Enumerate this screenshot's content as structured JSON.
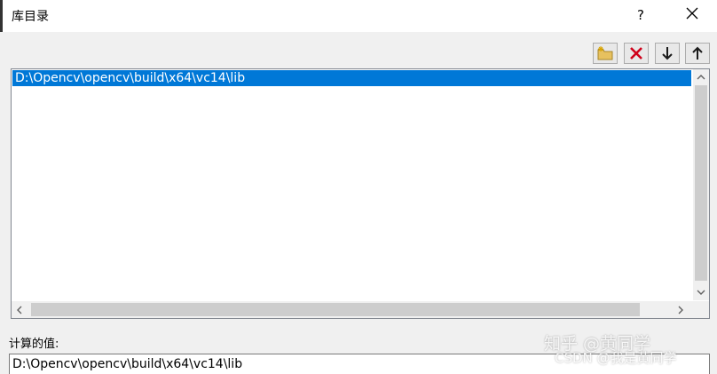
{
  "dialog": {
    "title": "库目录",
    "help_label": "?"
  },
  "toolbar": {
    "buttons": [
      {
        "name": "new-line-icon"
      },
      {
        "name": "delete-icon"
      },
      {
        "name": "move-down-icon"
      },
      {
        "name": "move-up-icon"
      }
    ]
  },
  "list": {
    "items": [
      "D:\\Opencv\\opencv\\build\\x64\\vc14\\lib"
    ]
  },
  "computed": {
    "label": "计算的值:",
    "value": "D:\\Opencv\\opencv\\build\\x64\\vc14\\lib"
  },
  "watermark": {
    "zhihu": "知乎 @黄同学",
    "csdn": "CSDN @我是黄同学"
  },
  "colors": {
    "selection": "#0078d7",
    "delete_red": "#d0021b",
    "panel": "#f0f0f0"
  }
}
